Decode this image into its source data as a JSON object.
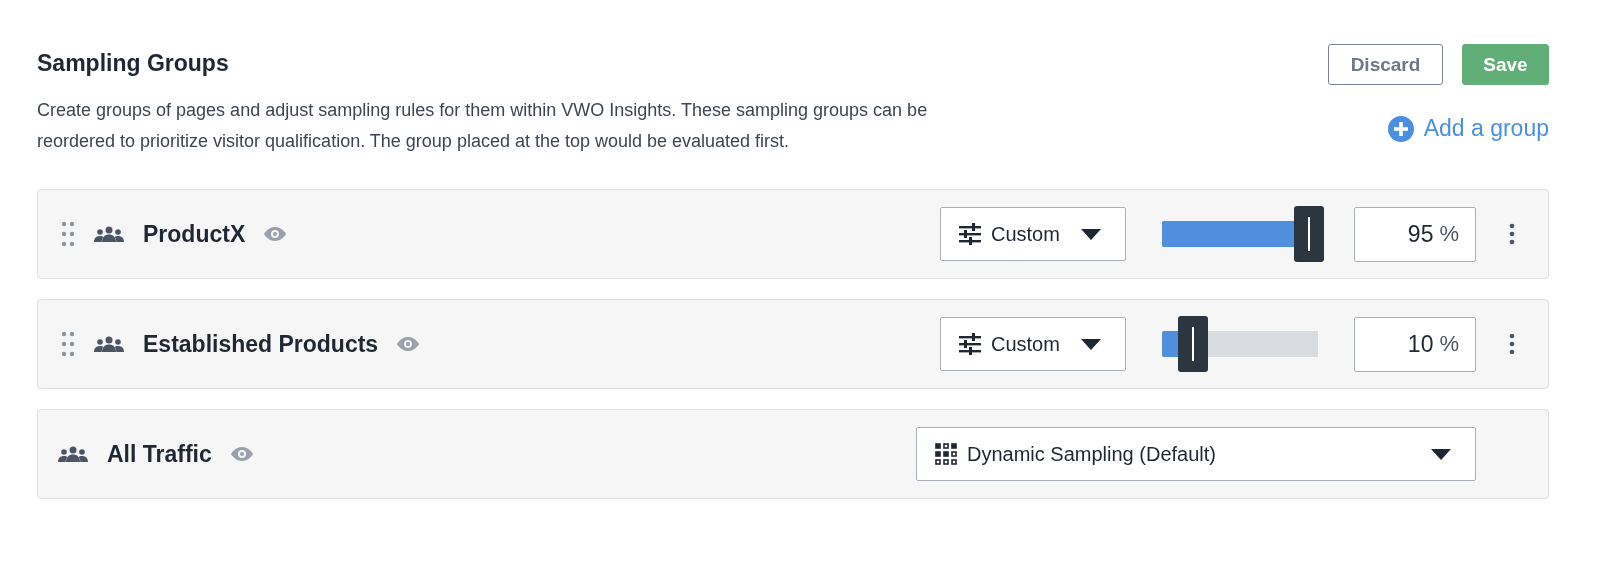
{
  "header": {
    "title": "Sampling Groups",
    "description": "Create groups of pages and adjust sampling rules for them within VWO Insights. These sampling groups can be reordered to prioritize visitor qualification. The group placed at the top would be evaluated first.",
    "buttons": [
      "Discard",
      "Save"
    ],
    "add_link": "Add a group"
  },
  "groups": [
    {
      "kind": "custom",
      "name": "ProductX",
      "mode": "Custom",
      "level": 0.95,
      "value": "95",
      "unit": "%"
    },
    {
      "kind": "custom",
      "name": "Established Products",
      "mode": "Custom",
      "level": 0.1,
      "value": "10",
      "unit": "%"
    },
    {
      "kind": "default",
      "name": "All Traffic",
      "mode": "Dynamic Sampling (Default)"
    }
  ]
}
